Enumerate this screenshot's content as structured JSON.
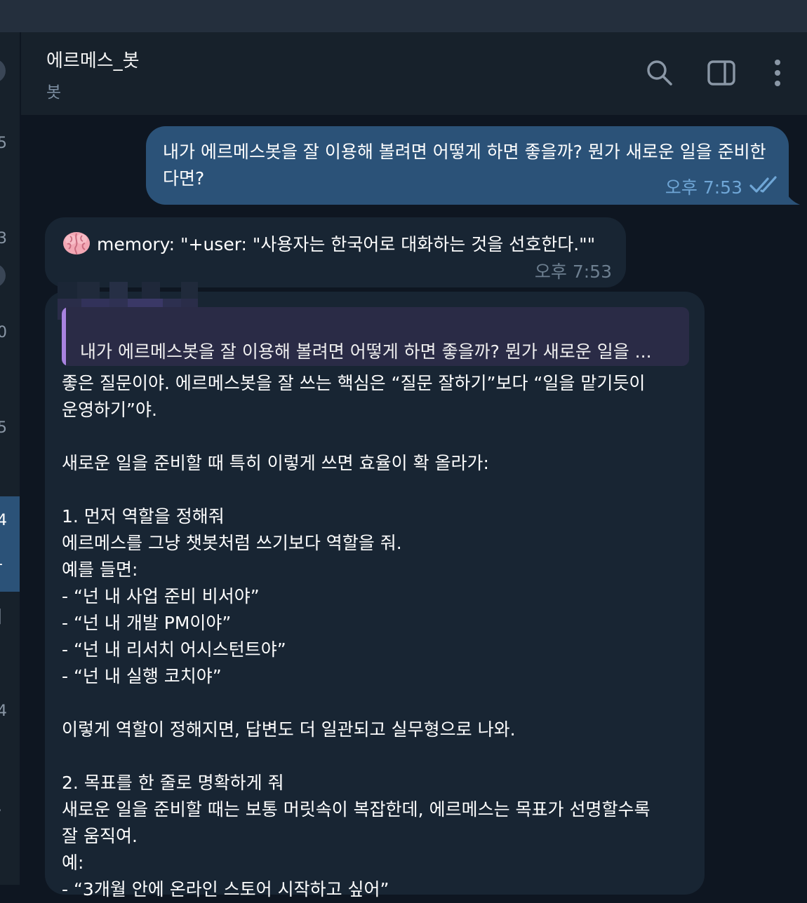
{
  "header": {
    "title": "에르메스_봇",
    "subtitle": "봇",
    "icons": [
      "search-icon",
      "sidebar-toggle-icon",
      "more-vertical-icon"
    ]
  },
  "left_panel": {
    "marks": [
      "5",
      "3",
      "0",
      "5",
      "4",
      "-",
      "|",
      "4",
      "."
    ]
  },
  "messages": {
    "outgoing": {
      "text": "내가 에르메스봇을 잘 이용해 볼려면 어떻게 하면 좋을까? 뭔가 새로운 일을 준비한다면?",
      "time": "오후 7:53",
      "status_icon": "double-check-icon"
    },
    "memory": {
      "icon": "brain-emoji",
      "text": "memory: \"+user: \"사용자는 한국어로 대화하는 것을 선호한다.\"\"",
      "time": "오후 7:53"
    },
    "reply": {
      "quote": "내가 에르메스봇을 잘 이용해 볼려면 어떻게 하면 좋을까? 뭔가 새로운 일을 ...",
      "lines": [
        "좋은 질문이야. 에르메스봇을 잘 쓰는 핵심은 “질문 잘하기”보다 “일을 맡기듯이",
        "운영하기”야.",
        "",
        "새로운 일을 준비할 때 특히 이렇게 쓰면 효율이 확 올라가:",
        "",
        "1. 먼저 역할을 정해줘",
        "에르메스를 그냥 챗봇처럼 쓰기보다 역할을 줘.",
        "예를 들면:",
        "- “넌 내 사업 준비 비서야”",
        "- “넌 내 개발 PM이야”",
        "- “넌 내 리서치 어시스턴트야”",
        "- “넌 내 실행 코치야”",
        "",
        "이렇게 역할이 정해지면, 답변도 더 일관되고 실무형으로 나와.",
        "",
        "2. 목표를 한 줄로 명확하게 줘",
        "새로운 일을 준비할 때는 보통 머릿속이 복잡한데, 에르메스는 목표가 선명할수록",
        "잘 움직여.",
        "예:",
        "- “3개월 안에 온라인 스토어 시작하고 싶어”"
      ]
    }
  },
  "colors": {
    "background": "#0e1621",
    "header": "#17212b",
    "outgoing_bubble": "#2b5278",
    "incoming_bubble": "#182533",
    "quote_bar": "#a883df",
    "check": "#6fa6d6"
  }
}
